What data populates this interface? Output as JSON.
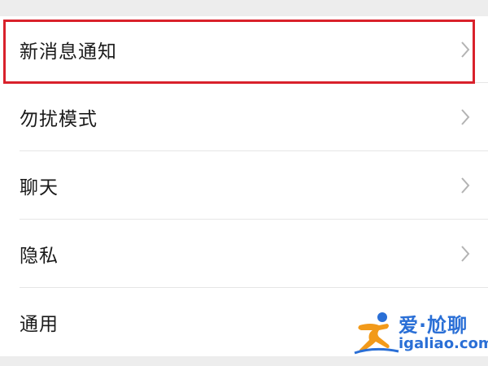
{
  "settings": {
    "items": [
      {
        "label": "新消息通知"
      },
      {
        "label": "勿扰模式"
      },
      {
        "label": "聊天"
      },
      {
        "label": "隐私"
      },
      {
        "label": "通用"
      }
    ]
  },
  "watermark": {
    "brand_cn": "爱·尬聊",
    "url": "igaliao.com"
  },
  "colors": {
    "highlight": "#d9212b",
    "watermark_blue": "#2a6fd6",
    "watermark_orange": "#f29a1a"
  }
}
